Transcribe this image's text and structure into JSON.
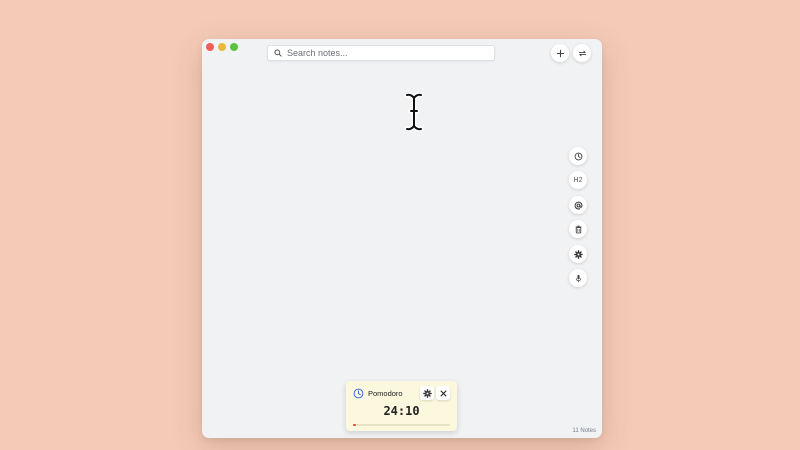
{
  "window": {
    "traffic_lights": [
      "close",
      "minimize",
      "maximize"
    ]
  },
  "search": {
    "placeholder": "Search notes...",
    "value": "",
    "icon": "search-icon"
  },
  "toolbar": {
    "new_note_icon": "plus-icon",
    "sync_icon": "sync-icon"
  },
  "side_toolbar": [
    {
      "name": "history-button",
      "icon": "clock-icon",
      "label": ""
    },
    {
      "name": "heading-button",
      "icon": "heading-icon",
      "label": "H2"
    },
    {
      "name": "mention-button",
      "icon": "at-icon",
      "label": ""
    },
    {
      "name": "trash-button",
      "icon": "trash-icon",
      "label": ""
    },
    {
      "name": "settings-button",
      "icon": "gear-icon",
      "label": ""
    },
    {
      "name": "dictation-button",
      "icon": "microphone-icon",
      "label": ""
    }
  ],
  "pomodoro": {
    "title": "Pomodoro",
    "time": "24:10",
    "progress_fraction": 0.033,
    "progress_color": "#e04a3a"
  },
  "footer": {
    "notes_count": "11 Notes"
  },
  "colors": {
    "background": "#f4cbb7",
    "window": "#f0f2f4",
    "pomodoro_bg": "#fbf8de"
  }
}
